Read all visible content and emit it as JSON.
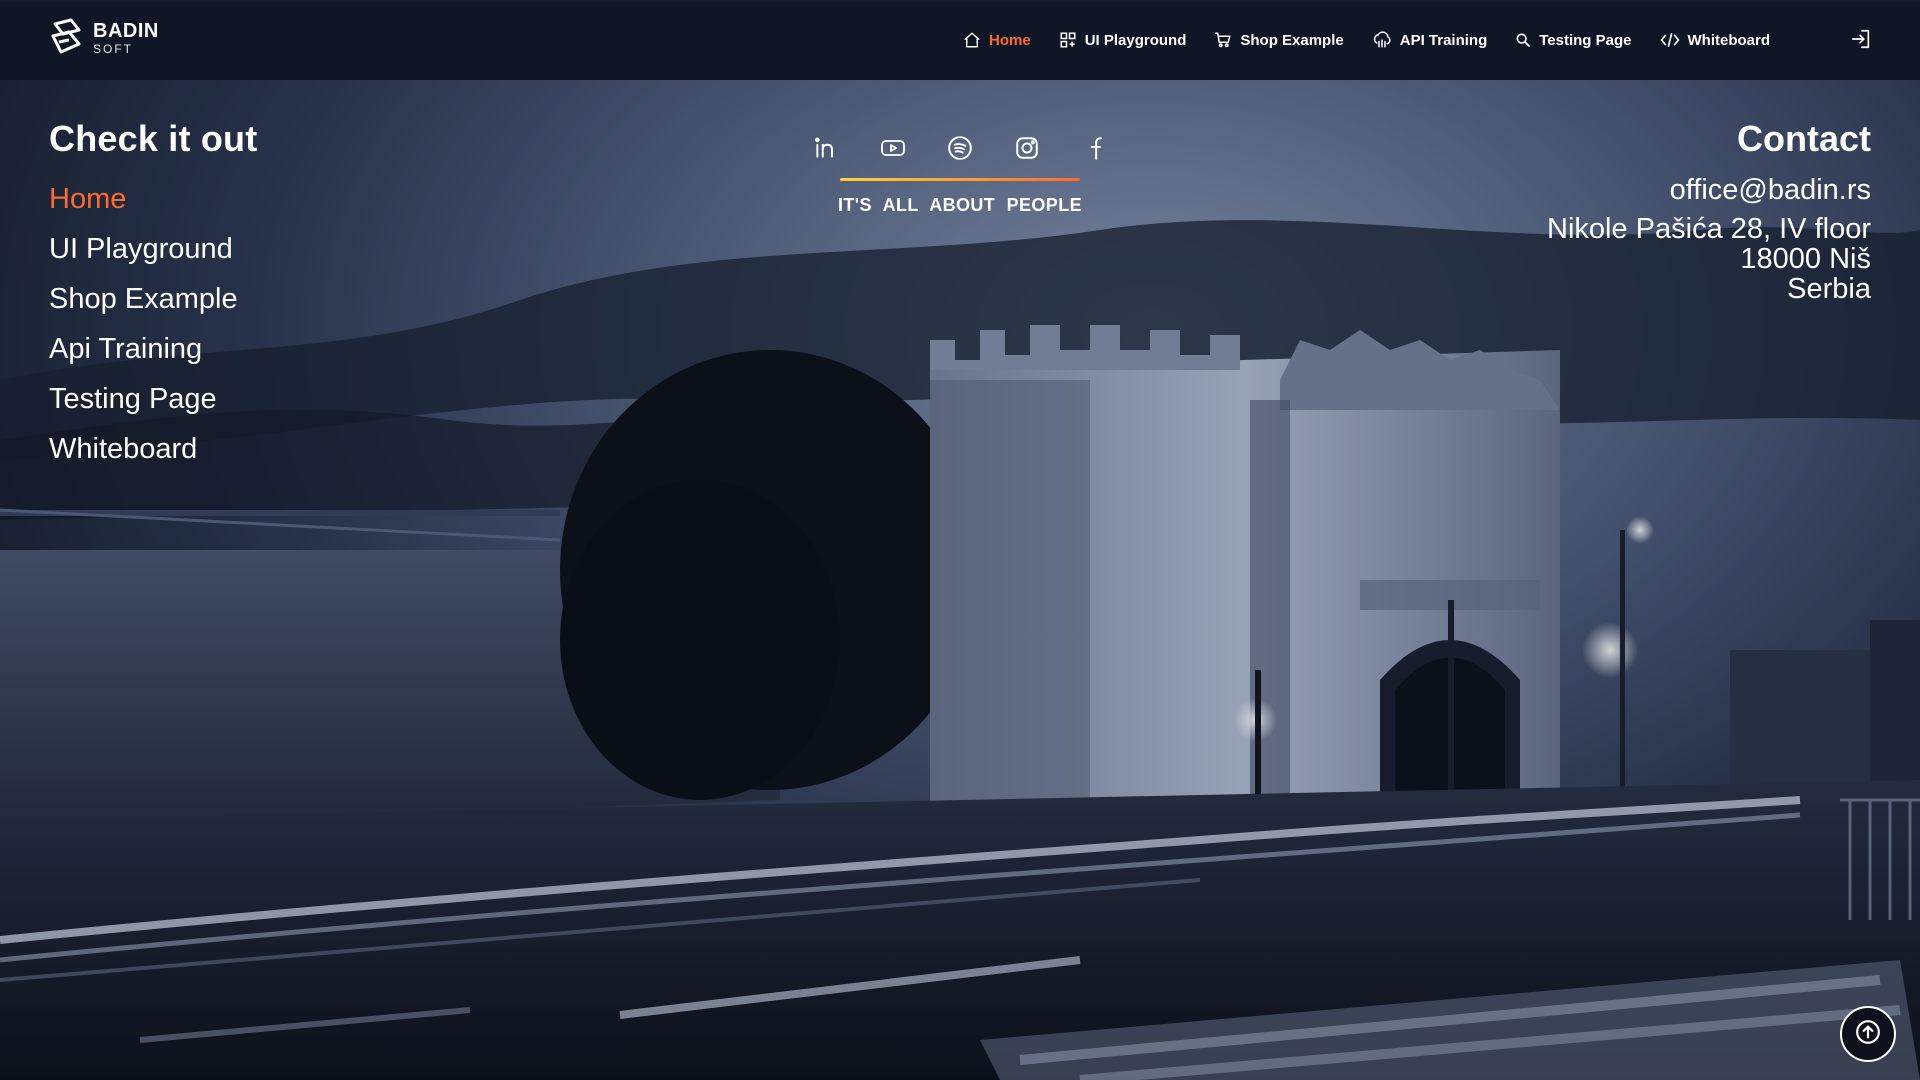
{
  "header": {
    "logo": {
      "brand": "BADIN",
      "sub": "SOFT",
      "icon": "badin-logo-mark"
    },
    "nav": [
      {
        "label": "Home",
        "icon": "home-icon",
        "active": true
      },
      {
        "label": "UI Playground",
        "icon": "grid-icon",
        "active": false
      },
      {
        "label": "Shop Example",
        "icon": "cart-icon",
        "active": false
      },
      {
        "label": "API Training",
        "icon": "api-icon",
        "active": false
      },
      {
        "label": "Testing Page",
        "icon": "search-icon",
        "active": false
      },
      {
        "label": "Whiteboard",
        "icon": "code-icon",
        "active": false
      }
    ],
    "logout_icon": "logout-icon"
  },
  "check": {
    "title": "Check it out",
    "links": [
      {
        "label": "Home",
        "active": true
      },
      {
        "label": "UI Playground",
        "active": false
      },
      {
        "label": "Shop Example",
        "active": false
      },
      {
        "label": "Api Training",
        "active": false
      },
      {
        "label": "Testing Page",
        "active": false
      },
      {
        "label": "Whiteboard",
        "active": false
      }
    ]
  },
  "social": {
    "icons": [
      "linkedin-icon",
      "youtube-icon",
      "spotify-icon",
      "instagram-icon",
      "facebook-icon"
    ],
    "slogan": "IT'S ALL ABOUT PEOPLE"
  },
  "contact": {
    "title": "Contact",
    "email": "office@badin.rs",
    "address": [
      "Nikole Pašića 28, IV floor",
      "18000 Niš",
      "Serbia"
    ]
  },
  "colors": {
    "accent": "#ff6a2d",
    "accent_gradient_start": "#ffd23a",
    "topbar_bg": "#0f1726",
    "text": "#ffffff"
  }
}
